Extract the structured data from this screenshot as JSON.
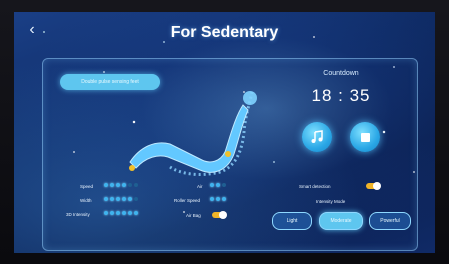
{
  "header": {
    "back_icon": "chevron-left-icon",
    "title": "For Sedentary"
  },
  "posture_button": {
    "label": "Double pulse sensing feet"
  },
  "countdown": {
    "label": "Countdown",
    "value": "18 : 35"
  },
  "controls": {
    "music_icon": "music-note-icon",
    "stop_icon": "stop-icon"
  },
  "settings": {
    "speed": {
      "label": "Speed",
      "level": 4,
      "max": 6
    },
    "width": {
      "label": "Width",
      "level": 5,
      "max": 6
    },
    "3d_intensity": {
      "label": "3D Intensity",
      "level": 6,
      "max": 6
    },
    "air": {
      "label": "Air",
      "level": 2,
      "max": 3
    },
    "roller_speed": {
      "label": "Roller Speed",
      "level": 3,
      "max": 3
    },
    "air_bag": {
      "label": "Air Bag",
      "on": true
    },
    "smart_detection": {
      "label": "Smart detection",
      "on": true
    }
  },
  "intensity_mode": {
    "label": "Intensity Mode",
    "options": [
      "Light",
      "Moderate",
      "Powerful"
    ],
    "selected": "Moderate"
  },
  "colors": {
    "accent": "#5ec6ef",
    "toggle_on": "#f0b428",
    "panel_bg": "#0e2a63"
  }
}
